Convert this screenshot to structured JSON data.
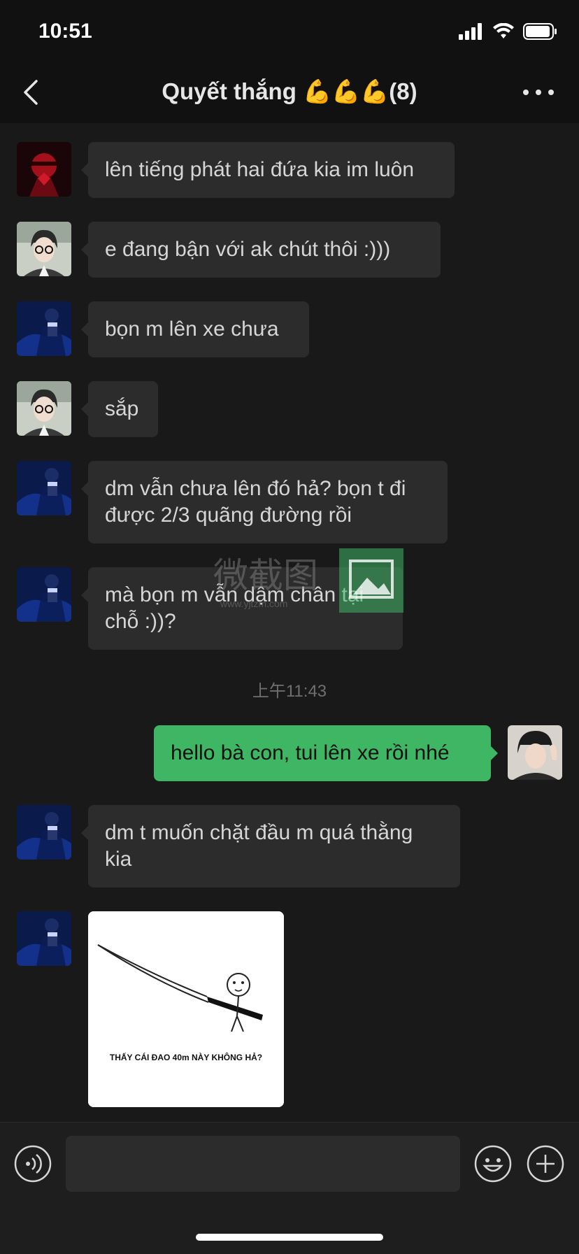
{
  "status_bar": {
    "time": "10:51"
  },
  "nav": {
    "title": "Quyết thắng 💪💪💪(8)"
  },
  "messages": [
    {
      "text": "lên tiếng phát hai đứa kia im luôn"
    },
    {
      "text": "e đang bận với ak chút thôi :)))"
    },
    {
      "text": "bọn m lên xe chưa"
    },
    {
      "text": "sắp"
    },
    {
      "text": "dm vẫn chưa lên đó hả? bọn t đi được 2/3 quãng đường rồi"
    },
    {
      "text": "mà bọn m vẫn dậm chân tại chỗ :))?"
    },
    {
      "text": "hello bà con, tui lên xe rồi nhé"
    },
    {
      "text": "dm t muốn chặt đầu m quá thằng kia"
    }
  ],
  "timestamp": "上午11:43",
  "image_caption": "THẤY CÁI ĐAO 40m NÀY KHÔNG HẢ?",
  "watermark": {
    "text": "微截图",
    "url": "www.yjtzm.com"
  },
  "input": {
    "placeholder": ""
  },
  "colors": {
    "my_bubble": "#3eb664",
    "other_bubble": "#2c2c2c",
    "background": "#191919"
  }
}
